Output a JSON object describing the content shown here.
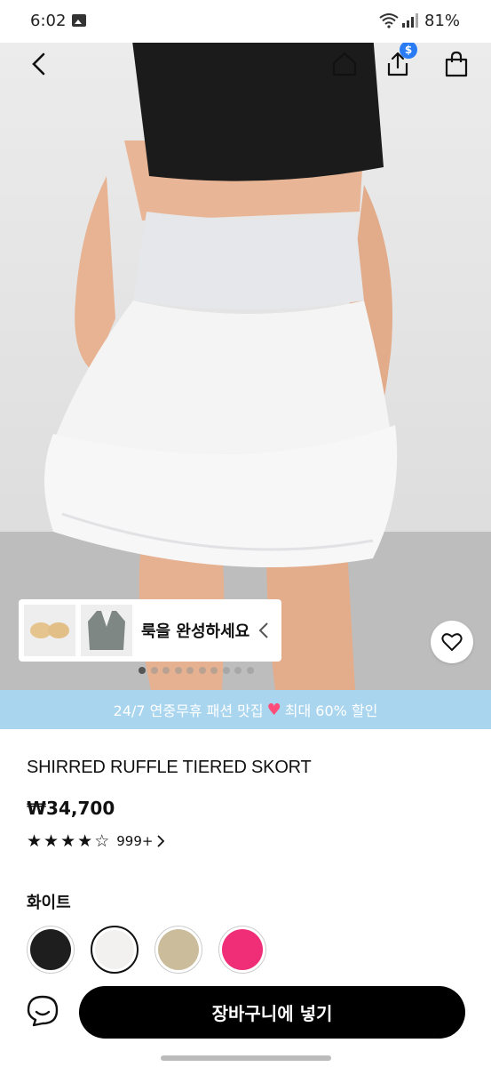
{
  "status_bar": {
    "time": "6:02",
    "battery": "81%",
    "icons": [
      "gallery-icon",
      "wifi-icon",
      "signal-icon"
    ]
  },
  "header": {
    "icons": [
      "back-arrow-icon",
      "home-icon",
      "share-icon",
      "shopping-bag-icon"
    ],
    "share_badge": "$"
  },
  "hero": {
    "outfit_label": "룩을 완성하세요",
    "outfit_thumbs": [
      "bra-icon",
      "cardigan-icon"
    ],
    "image_count": 10,
    "active_index": 0
  },
  "promo": {
    "text_before": "24/7 연중무휴 패션 맛집",
    "heart": "♥",
    "text_after": "최대 60% 할인"
  },
  "product": {
    "title": "SHIRRED RUFFLE TIERED SKORT",
    "price": "₩34,700",
    "rating": 4,
    "rating_max": 5,
    "review_count": "999+"
  },
  "color": {
    "selected_name": "화이트",
    "swatches": [
      {
        "name": "black",
        "color": "#1e1e1e"
      },
      {
        "name": "white",
        "color": "#f2f1ef"
      },
      {
        "name": "beige",
        "color": "#cbbd9c"
      },
      {
        "name": "pink",
        "color": "#f02e78"
      }
    ],
    "selected_index": 1
  },
  "footer": {
    "add_to_cart": "장바구니에 넣기",
    "chat_icon": "chat-icon"
  },
  "colors": {
    "promo_bg": "#a9d5ee",
    "button_bg": "#000000",
    "badge_blue": "#2a7cf6"
  }
}
